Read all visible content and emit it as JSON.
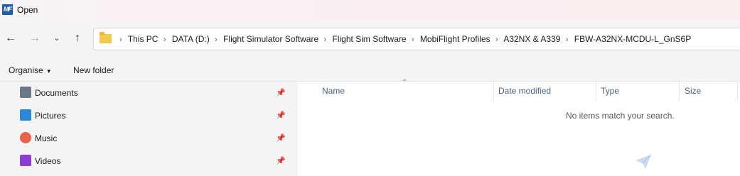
{
  "window": {
    "title": "Open",
    "app_icon_text": "MF"
  },
  "nav": {
    "back_icon": "arrow-left-icon",
    "forward_icon": "arrow-right-icon",
    "recent_icon": "chevron-down-icon",
    "up_icon": "arrow-up-icon"
  },
  "address": {
    "crumbs": [
      "This PC",
      "DATA (D:)",
      "Flight Simulator Software",
      "Flight Sim Software",
      "MobiFlight Profiles",
      "A32NX & A339",
      "FBW-A32NX-MCDU-L_GnS6P"
    ]
  },
  "toolbar": {
    "organise_label": "Organise",
    "new_folder_label": "New folder"
  },
  "sidebar": {
    "items": [
      {
        "label": "Documents",
        "icon": "documents-icon",
        "color": "#6b7785"
      },
      {
        "label": "Pictures",
        "icon": "pictures-icon",
        "color": "#2b88d8"
      },
      {
        "label": "Music",
        "icon": "music-icon",
        "color": "#e8644b"
      },
      {
        "label": "Videos",
        "icon": "videos-icon",
        "color": "#8a3fd1"
      }
    ]
  },
  "columns": {
    "name": "Name",
    "date": "Date modified",
    "type": "Type",
    "size": "Size"
  },
  "content": {
    "empty_message": "No items match your search."
  }
}
